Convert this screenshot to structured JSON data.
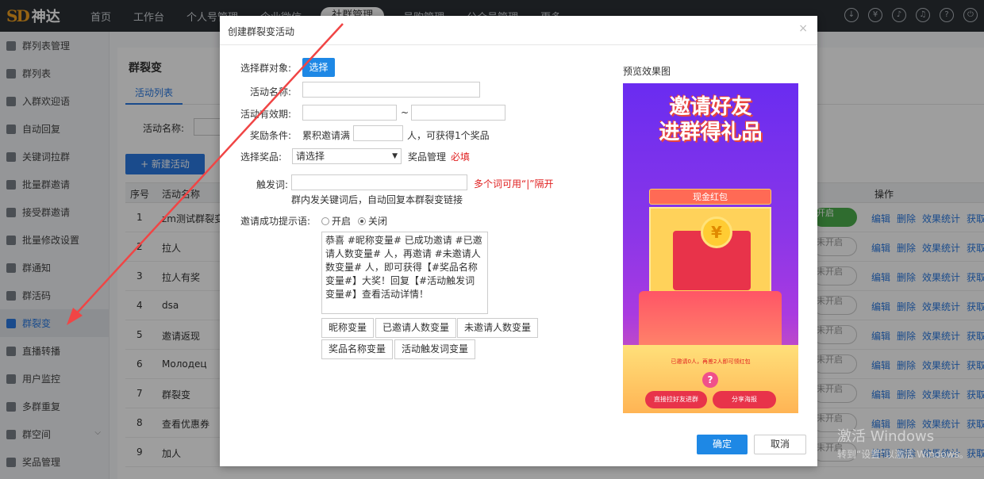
{
  "topbar": {
    "logo_mark": "SD",
    "logo_name": "神达",
    "nav": [
      "首页",
      "工作台",
      "个人号管理",
      "企业微信",
      "社群管理",
      "号购管理",
      "公众号管理",
      "更多"
    ],
    "nav_active": 4
  },
  "sidebar": {
    "items": [
      {
        "label": "群列表管理",
        "icon": "group-icon"
      },
      {
        "label": "群列表",
        "icon": "group-icon"
      },
      {
        "label": "入群欢迎语",
        "icon": "welcome-icon"
      },
      {
        "label": "自动回复",
        "icon": "chat-icon"
      },
      {
        "label": "关键词拉群",
        "icon": "group-icon"
      },
      {
        "label": "批量群邀请",
        "icon": "invite-icon"
      },
      {
        "label": "接受群邀请",
        "icon": "accept-icon"
      },
      {
        "label": "批量修改设置",
        "icon": "settings-icon"
      },
      {
        "label": "群通知",
        "icon": "bell-icon"
      },
      {
        "label": "群活码",
        "icon": "qrcode-icon"
      },
      {
        "label": "群裂变",
        "icon": "share-icon"
      },
      {
        "label": "直播转播",
        "icon": "video-icon"
      },
      {
        "label": "用户监控",
        "icon": "monitor-icon"
      },
      {
        "label": "多群重复",
        "icon": "group-icon"
      },
      {
        "label": "群空间",
        "icon": "space-icon"
      },
      {
        "label": "奖品管理",
        "icon": "gift-icon"
      }
    ],
    "active_index": 10
  },
  "page": {
    "title": "群裂变",
    "tab": "活动列表",
    "filter_label": "活动名称:",
    "new_button": "+ 新建活动",
    "columns": {
      "no": "序号",
      "name": "活动名称",
      "ops": "操作"
    },
    "rows": [
      {
        "no": "1",
        "name": "zm测试群裂变",
        "toggle": "开启"
      },
      {
        "no": "2",
        "name": "拉人",
        "toggle": "未开启"
      },
      {
        "no": "3",
        "name": "拉人有奖",
        "toggle": "未开启"
      },
      {
        "no": "4",
        "name": "dsa",
        "toggle": "未开启"
      },
      {
        "no": "5",
        "name": "邀请返现",
        "toggle": "未开启"
      },
      {
        "no": "6",
        "name": "Молодец",
        "toggle": "未开启"
      },
      {
        "no": "7",
        "name": "群裂变",
        "toggle": "未开启"
      },
      {
        "no": "8",
        "name": "查看优惠券",
        "toggle": "未开启"
      },
      {
        "no": "9",
        "name": "加人",
        "toggle": "未开启"
      }
    ],
    "ops": [
      "编辑",
      "删除",
      "效果统计",
      "获取链"
    ]
  },
  "dialog": {
    "title": "创建群裂变活动",
    "close": "×",
    "labels": {
      "target": "选择群对象:",
      "name": "活动名称:",
      "period": "活动有效期:",
      "condition": "奖励条件:",
      "prize": "选择奖品:",
      "trigger": "触发词:",
      "success": "邀请成功提示语:"
    },
    "select_button": "选择",
    "period_sep": "~",
    "condition_prefix": "累积邀请满",
    "condition_suffix": "人，可获得1个奖品",
    "prize_placeholder": "请选择",
    "prize_manage": "奖品管理",
    "required": "必填",
    "trigger_tip": "多个词可用“|”隔开",
    "trigger_desc": "群内发关键词后，自动回复本群裂变链接",
    "radio_on": "开启",
    "radio_off": "关闭",
    "message": "恭喜 #昵称变量# 已成功邀请 #已邀请人数变量# 人，再邀请 #未邀请人数变量# 人，即可获得【#奖品名称变量#】大奖！回复【#活动触发词变量#】查看活动详情！",
    "var_buttons": [
      "昵称变量",
      "已邀请人数变量",
      "未邀请人数变量",
      "奖品名称变量",
      "活动触发词变量"
    ],
    "preview_label": "预览效果图",
    "poster": {
      "title_line1": "邀请好友",
      "title_line2": "进群得礼品",
      "banner": "现金红包",
      "coin": "¥",
      "invited_text": "已邀请0人，再差2人即可领红包",
      "question": "?",
      "btn_join": "直接拉好友进群",
      "btn_share": "分享海报"
    },
    "ok": "确定",
    "cancel": "取消"
  },
  "watermark": {
    "line1": "激活 Windows",
    "line2": "转到“设置”以激活 Windows。"
  }
}
